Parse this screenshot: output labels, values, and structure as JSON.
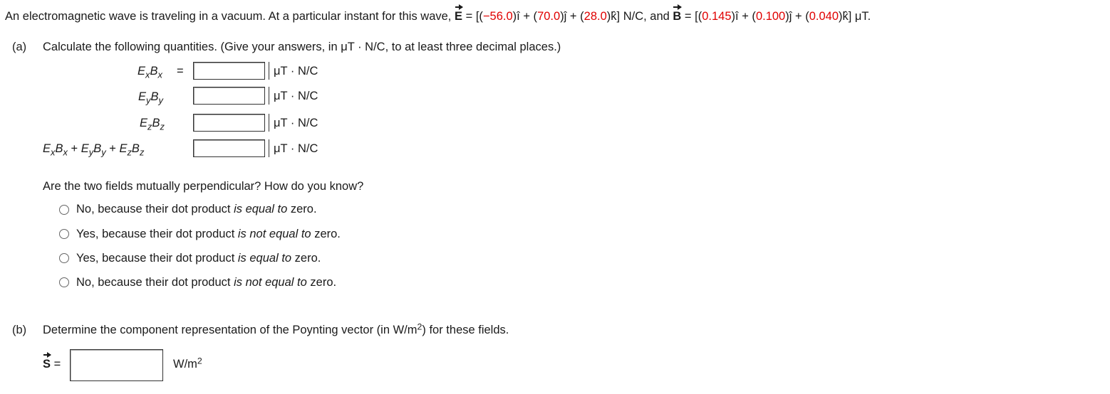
{
  "problem": {
    "intro": "An electromagnetic wave is traveling in a vacuum. At a particular instant for this wave,",
    "e_symbol": "E",
    "eq": "=",
    "open": "[(",
    "ex": "−56.0",
    "i_hat": ")î + (",
    "ey": "70.0",
    "j_hat": ")ĵ + (",
    "ez": "28.0",
    "k_hat_e": ")k̂] N/C, and",
    "b_symbol": "B",
    "eq2": "=",
    "open2": "[(",
    "bx": "0.145",
    "i_hat2": ")î + (",
    "by": "0.100",
    "j_hat2": ")ĵ + (",
    "bz": "0.040",
    "k_hat_b": ")k̂] μT."
  },
  "part_a": {
    "label": "(a)",
    "instruction": "Calculate the following quantities. (Give your answers, in μT · N/C, to at least three decimal places.)",
    "rows": [
      {
        "E": "E",
        "Es": "x",
        "B": "B",
        "Bs": "x",
        "eq": "=",
        "unit": "μT · N/C",
        "value": ""
      },
      {
        "E": "E",
        "Es": "y",
        "B": "B",
        "Bs": "y",
        "unit": "μT · N/C",
        "value": ""
      },
      {
        "E": "E",
        "Es": "z",
        "B": "B",
        "Bs": "z",
        "unit": "μT · N/C",
        "value": ""
      },
      {
        "sum_plus": "+",
        "unit": "μT · N/C",
        "value": ""
      }
    ],
    "question": "Are the two fields mutually perpendicular? How do you know?",
    "options": [
      {
        "pre": "No, because their dot product ",
        "em": "is equal to",
        "post": " zero."
      },
      {
        "pre": "Yes, because their dot product ",
        "em": "is not equal to",
        "post": " zero."
      },
      {
        "pre": "Yes, because their dot product ",
        "em": "is equal to",
        "post": " zero."
      },
      {
        "pre": "No, because their dot product ",
        "em": "is not equal to",
        "post": " zero."
      }
    ]
  },
  "part_b": {
    "label": "(b)",
    "instruction_pre": "Determine the component representation of the Poynting vector (in W/m",
    "instruction_sup": "2",
    "instruction_post": ") for these fields.",
    "s_symbol": "S",
    "eq": "=",
    "unit_base": "W/m",
    "unit_sup": "2",
    "value": ""
  },
  "colors": {
    "given_values": "#e00000",
    "text": "#1a1a1a"
  }
}
